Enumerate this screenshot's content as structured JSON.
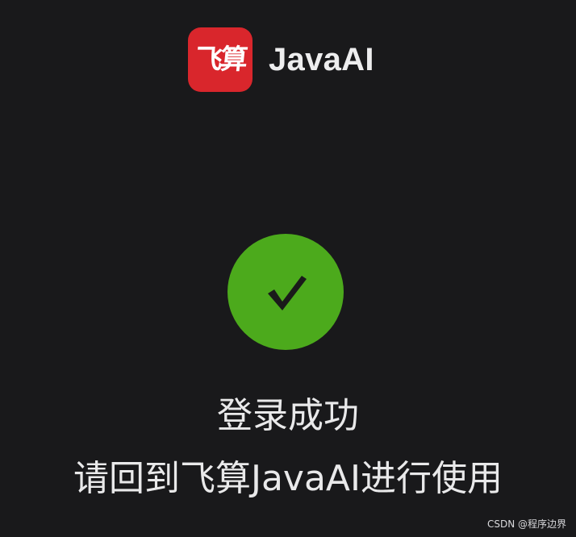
{
  "brand": {
    "logo_text": "飞算",
    "app_name": "JavaAI",
    "logo_color": "#d9262c"
  },
  "status": {
    "icon": "check-icon",
    "color": "#4caa1c",
    "title": "登录成功",
    "message": "请回到飞算JavaAI进行使用"
  },
  "watermark": "CSDN @程序边界"
}
